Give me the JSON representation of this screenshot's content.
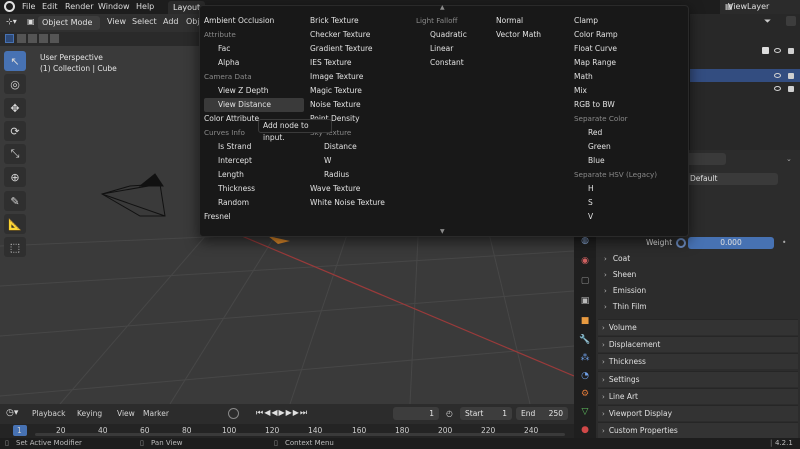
{
  "topbar": {
    "menus": [
      "File",
      "Edit",
      "Render",
      "Window",
      "Help"
    ],
    "workspace_tab": "Layout",
    "view_layer": "ViewLayer"
  },
  "viewport_header": {
    "mode": "Object Mode",
    "menus": [
      "View",
      "Select",
      "Add",
      "Obj"
    ]
  },
  "viewport": {
    "perspective": "User Perspective",
    "collection": "(1) Collection | Cube"
  },
  "node_menu": {
    "col1": [
      {
        "t": "item",
        "label": "Ambient Occlusion"
      },
      {
        "t": "head",
        "label": "Attribute"
      },
      {
        "t": "sub",
        "label": "Fac"
      },
      {
        "t": "sub",
        "label": "Alpha"
      },
      {
        "t": "head",
        "label": "Camera Data"
      },
      {
        "t": "sub",
        "label": "View Z Depth"
      },
      {
        "t": "sub",
        "label": "View Distance",
        "hl": true
      },
      {
        "t": "item",
        "label": "Color Attribute"
      },
      {
        "t": "head",
        "label": "Curves Info"
      },
      {
        "t": "sub",
        "label": "Is Strand"
      },
      {
        "t": "sub",
        "label": "Intercept"
      },
      {
        "t": "sub",
        "label": "Length"
      },
      {
        "t": "sub",
        "label": "Thickness"
      },
      {
        "t": "sub",
        "label": "Random"
      },
      {
        "t": "item",
        "label": "Fresnel"
      }
    ],
    "col2": [
      {
        "t": "item",
        "label": "Brick Texture"
      },
      {
        "t": "item",
        "label": "Checker Texture"
      },
      {
        "t": "item",
        "label": "Gradient Texture"
      },
      {
        "t": "item",
        "label": "IES Texture"
      },
      {
        "t": "item",
        "label": "Image Texture"
      },
      {
        "t": "item",
        "label": "Magic Texture"
      },
      {
        "t": "item",
        "label": "Noise Texture"
      },
      {
        "t": "item",
        "label": "Point Density"
      },
      {
        "t": "head",
        "label": "Sky Texture"
      },
      {
        "t": "sub2",
        "label": "Distance"
      },
      {
        "t": "sub2",
        "label": "W"
      },
      {
        "t": "sub2",
        "label": "Radius"
      },
      {
        "t": "item",
        "label": "Wave Texture"
      },
      {
        "t": "item",
        "label": "White Noise Texture"
      }
    ],
    "col3": [
      {
        "t": "head",
        "label": "Light Falloff"
      },
      {
        "t": "sub",
        "label": "Quadratic"
      },
      {
        "t": "sub",
        "label": "Linear"
      },
      {
        "t": "sub",
        "label": "Constant"
      }
    ],
    "col4": [
      {
        "t": "item",
        "label": "Normal"
      },
      {
        "t": "item",
        "label": "Vector Math"
      }
    ],
    "col5": [
      {
        "t": "item",
        "label": "Clamp"
      },
      {
        "t": "item",
        "label": "Color Ramp"
      },
      {
        "t": "item",
        "label": "Float Curve"
      },
      {
        "t": "item",
        "label": "Map Range"
      },
      {
        "t": "item",
        "label": "Math"
      },
      {
        "t": "item",
        "label": "Mix"
      },
      {
        "t": "item",
        "label": "RGB to BW"
      },
      {
        "t": "head",
        "label": "Separate Color"
      },
      {
        "t": "sub",
        "label": "Red"
      },
      {
        "t": "sub",
        "label": "Green"
      },
      {
        "t": "sub",
        "label": "Blue"
      },
      {
        "t": "head",
        "label": "Separate HSV (Legacy)"
      },
      {
        "t": "sub",
        "label": "H"
      },
      {
        "t": "sub",
        "label": "S"
      },
      {
        "t": "sub",
        "label": "V"
      }
    ],
    "tooltip": "Add node to input."
  },
  "properties": {
    "surface_value": "Default",
    "weight_label": "Weight",
    "weight_value": "0.000",
    "sub_panels": [
      "Coat",
      "Sheen",
      "Emission",
      "Thin Film"
    ],
    "panels": [
      "Volume",
      "Displacement",
      "Thickness",
      "Settings",
      "Line Art",
      "Viewport Display",
      "Custom Properties"
    ]
  },
  "timeline": {
    "menus": [
      "Playback",
      "Keying",
      "View",
      "Marker"
    ],
    "current_frame": "1",
    "start_label": "Start",
    "start_value": "1",
    "end_label": "End",
    "end_value": "250",
    "ruler": [
      "1",
      "20",
      "40",
      "60",
      "80",
      "100",
      "120",
      "140",
      "160",
      "180",
      "200",
      "220",
      "240"
    ]
  },
  "statusbar": {
    "left": "Set Active Modifier",
    "mid": "Pan View",
    "right": "Context Menu",
    "version": "4.2.1"
  },
  "colors": {
    "accent": "#4772b3",
    "menu_bg": "#181818",
    "selection": "#334d80",
    "frame_marker": "#4772b3"
  }
}
